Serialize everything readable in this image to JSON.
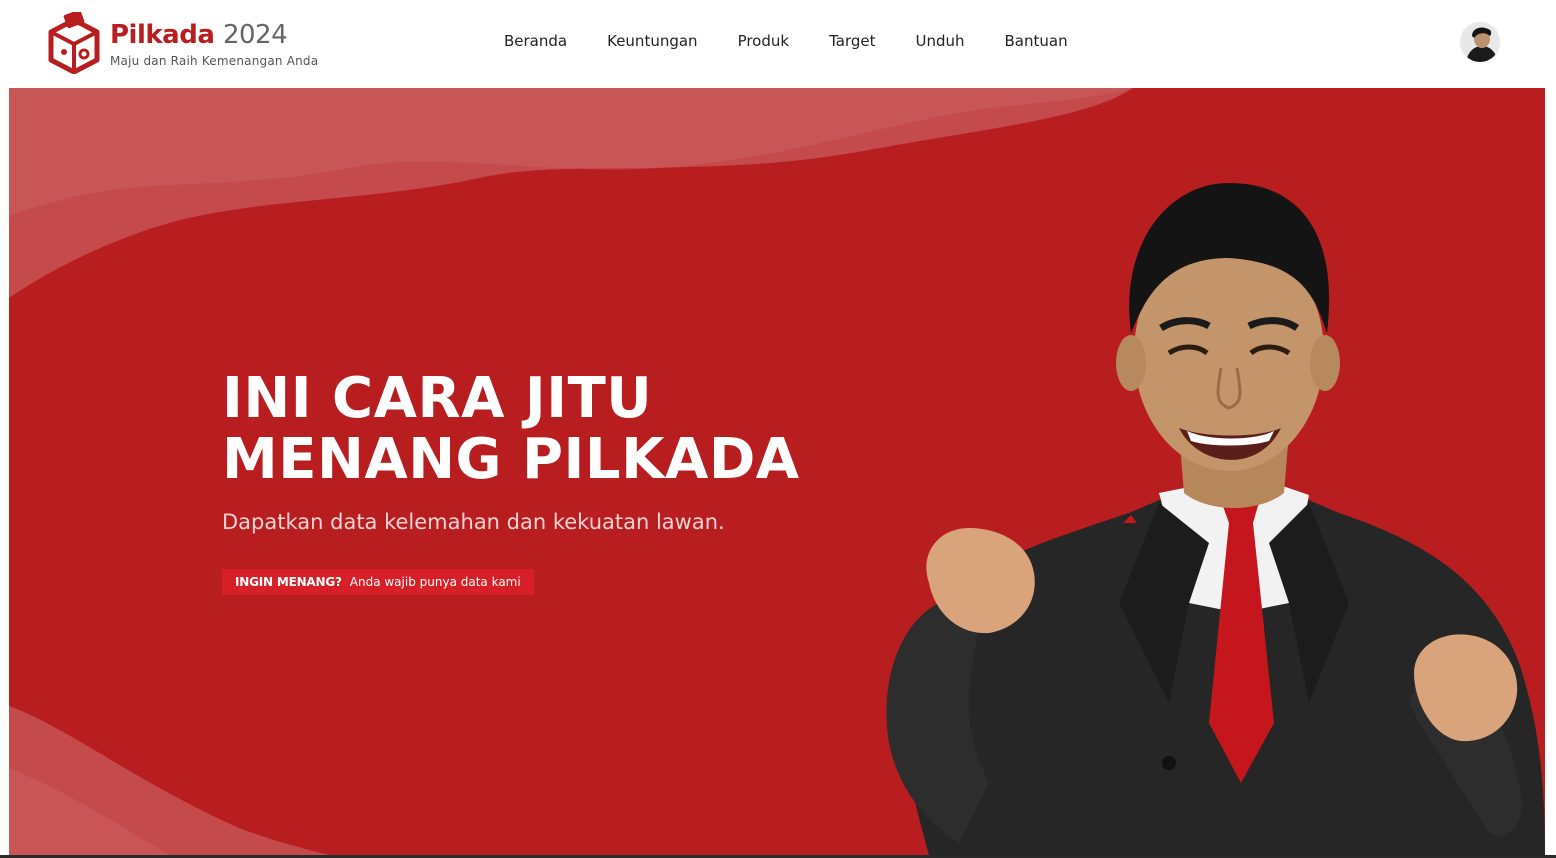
{
  "brand": {
    "name_primary": "Pilkada",
    "name_year": "2024",
    "tagline": "Maju dan Raih Kemenangan Anda"
  },
  "nav": {
    "items": [
      {
        "label": "Beranda"
      },
      {
        "label": "Keuntungan"
      },
      {
        "label": "Produk"
      },
      {
        "label": "Target"
      },
      {
        "label": "Unduh"
      },
      {
        "label": "Bantuan"
      }
    ]
  },
  "hero": {
    "headline_line1": "INI CARA JITU",
    "headline_line2": "MENANG PILKADA",
    "subheadline": "Dapatkan data kelemahan dan kekuatan lawan.",
    "cta_bold": "INGIN MENANG?",
    "cta_text": "Anda wajib punya data kami"
  },
  "colors": {
    "brand_red": "#b81d20",
    "cta_red": "#d61f26"
  },
  "icons": {
    "logo": "ballot-box-icon",
    "avatar": "user-avatar"
  }
}
